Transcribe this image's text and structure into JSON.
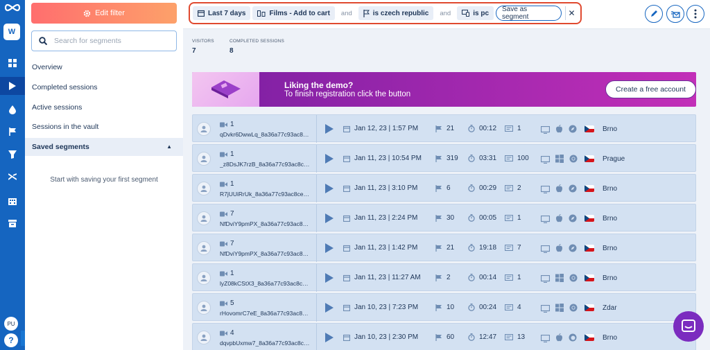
{
  "sidebar": {
    "workspace_initial": "W",
    "user_initials": "PU",
    "help_label": "?",
    "edit_filter_label": "Edit filter",
    "search_placeholder": "Search for segments",
    "nav": {
      "overview": "Overview",
      "completed": "Completed sessions",
      "active": "Active sessions",
      "vault": "Sessions in the vault",
      "saved": "Saved segments"
    },
    "empty_text": "Start with saving your first segment"
  },
  "filters": {
    "date": "Last 7 days",
    "funnel": "Films - Add to cart",
    "and_1": "and",
    "country": "is czech republic",
    "and_2": "and",
    "device": "is pc",
    "save_label": "Save as segment"
  },
  "stats": {
    "visitors_label": "VISITORS",
    "visitors_value": "7",
    "completed_label": "COMPLETED SESSIONS",
    "completed_value": "8"
  },
  "promo": {
    "title": "Liking the demo?",
    "text": "To finish registration click the button",
    "cta": "Create a free account"
  },
  "sessions": [
    {
      "count": "1",
      "id": "qDvkr6DwwLq_8a36a77c93ac8ce6...",
      "date": "Jan 12, 23 | 1:57 PM",
      "pages": "21",
      "duration": "00:12",
      "events": "1",
      "os": "mac",
      "browser": "safari",
      "city": "Brno"
    },
    {
      "count": "1",
      "id": "_z8DsJK7rzB_8a36a77c93ac8ce6...",
      "date": "Jan 11, 23 | 10:54 PM",
      "pages": "319",
      "duration": "03:31",
      "events": "100",
      "os": "windows",
      "browser": "chrome",
      "city": "Prague"
    },
    {
      "count": "1",
      "id": "R7jUUiRrUk_8a36a77c93ac8ce6...",
      "date": "Jan 11, 23 | 3:10 PM",
      "pages": "6",
      "duration": "00:29",
      "events": "2",
      "os": "mac",
      "browser": "safari",
      "city": "Brno"
    },
    {
      "count": "7",
      "id": "NfDviY9pmPX_8a36a77c93ac8ce6...",
      "date": "Jan 11, 23 | 2:24 PM",
      "pages": "30",
      "duration": "00:05",
      "events": "1",
      "os": "mac",
      "browser": "safari",
      "city": "Brno"
    },
    {
      "count": "7",
      "id": "NfDviY9pmPX_8a36a77c93ac8ce6...",
      "date": "Jan 11, 23 | 1:42 PM",
      "pages": "21",
      "duration": "19:18",
      "events": "7",
      "os": "mac",
      "browser": "safari",
      "city": "Brno"
    },
    {
      "count": "1",
      "id": "lyZ08kCStX3_8a36a77c93ac8ce6...",
      "date": "Jan 11, 23 | 11:27 AM",
      "pages": "2",
      "duration": "00:14",
      "events": "1",
      "os": "windows",
      "browser": "chrome",
      "city": "Brno"
    },
    {
      "count": "5",
      "id": "rHovomrC7eE_8a36a77c93ac8ce6...",
      "date": "Jan 10, 23 | 7:23 PM",
      "pages": "10",
      "duration": "00:24",
      "events": "4",
      "os": "windows",
      "browser": "chrome",
      "city": "Zdar"
    },
    {
      "count": "4",
      "id": "dqvpbUxmw7_8a36a77c93ac8ce6...",
      "date": "Jan 10, 23 | 2:30 PM",
      "pages": "60",
      "duration": "12:47",
      "events": "13",
      "os": "mac",
      "browser": "firefox",
      "city": "Brno"
    }
  ]
}
